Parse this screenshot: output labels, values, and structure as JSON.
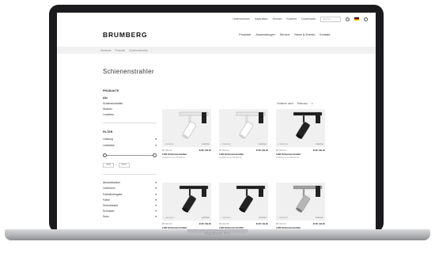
{
  "device": {
    "label": "MacBook Pro"
  },
  "topbar": {
    "links": [
      "Unternehmen",
      "Inspiration",
      "Service",
      "Karriere",
      "Downloads"
    ],
    "search_placeholder": "Suchen ..."
  },
  "header": {
    "logo": "BRUMBERG",
    "nav": [
      "Produkte",
      "Anwendungen",
      "Service",
      "News & Events",
      "Kontakt"
    ]
  },
  "breadcrumb": [
    "Startseite",
    "Produkte",
    "Schienenstrahler"
  ],
  "page": {
    "title": "Schienenstrahler"
  },
  "sidebar": {
    "products_head": "PRODUKTE",
    "product_links": [
      "Alle",
      "Schienenstrahler",
      "Strahler",
      "Leuchten"
    ],
    "filter_head": "FILTER",
    "filters": [
      "Leistung",
      "Lichtfarbe"
    ],
    "range": {
      "min": "3000",
      "max": "6000"
    },
    "facets": [
      "Abstrahlwinkel",
      "Lichtstrom",
      "Farbwiedergabe",
      "Farbe",
      "Dimmbarkeit",
      "Schutzart",
      "Serie"
    ]
  },
  "sort": {
    "label": "Sortieren nach",
    "value": "Relevanz"
  },
  "products": [
    {
      "tag": "+ Varianten",
      "stock": "Lieferbar",
      "number": "88 000 01",
      "price": "EUR 139,00",
      "title": "LED-Schienenstrahler",
      "sub": "Artikelnummer 88 000 01",
      "color": "white"
    },
    {
      "tag": "+ Varianten",
      "stock": "Lieferbar",
      "number": "88 000 02",
      "price": "EUR 139,00",
      "title": "LED-Schienenstrahler",
      "sub": "Artikelnummer 88 000 02",
      "color": "white"
    },
    {
      "tag": "+ Varianten",
      "stock": "Lieferbar",
      "number": "88 000 03",
      "price": "EUR 139,00",
      "title": "LED-Schienenstrahler",
      "sub": "Artikelnummer 88 000 03",
      "color": "black"
    },
    {
      "tag": "+ Varianten",
      "stock": "Lieferbar",
      "number": "88 000 04",
      "price": "EUR 149,00",
      "title": "LED-Schienenstrahler",
      "sub": "Artikelnummer 88 000 04",
      "color": "black"
    },
    {
      "tag": "+ Varianten",
      "stock": "Lieferbar",
      "number": "88 000 05",
      "price": "EUR 149,00",
      "title": "LED-Schienenstrahler",
      "sub": "Artikelnummer 88 000 05",
      "color": "black"
    },
    {
      "tag": "+ Varianten",
      "stock": "Lieferbar",
      "number": "88 000 06",
      "price": "EUR 149,00",
      "title": "LED-Schienenstrahler",
      "sub": "Artikelnummer 88 000 06",
      "color": "silver"
    }
  ]
}
